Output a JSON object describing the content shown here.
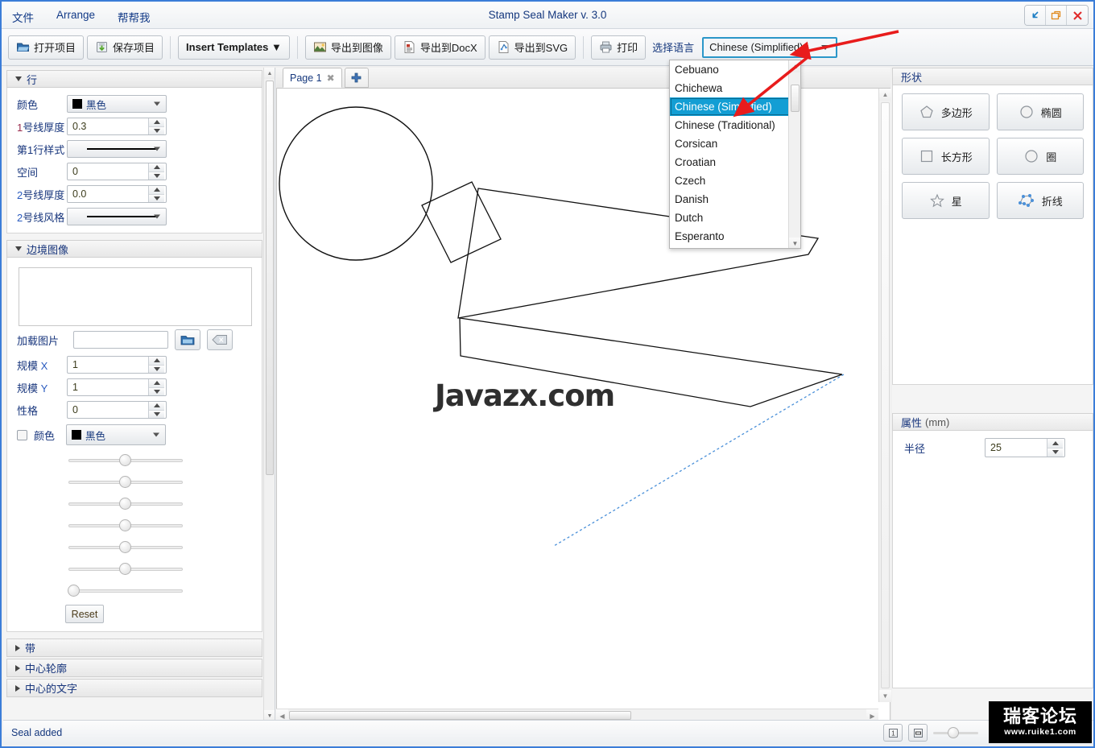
{
  "window": {
    "title": "Stamp Seal Maker v. 3.0",
    "menus": [
      "文件",
      "Arrange",
      "帮帮我"
    ],
    "controls": [
      {
        "name": "minimize-button",
        "glyph": "↙"
      },
      {
        "name": "restore-button",
        "glyph": "❐"
      },
      {
        "name": "close-button",
        "glyph": "✕"
      }
    ]
  },
  "toolbar": {
    "buttons": [
      {
        "label": "打开项目",
        "icon": "open-project-icon"
      },
      {
        "label": "保存项目",
        "icon": "save-project-icon"
      },
      {
        "label": "Insert Templates ▼",
        "icon": "none"
      },
      {
        "label": "导出到图像",
        "icon": "export-image-icon"
      },
      {
        "label": "导出到DocX",
        "icon": "export-docx-icon"
      },
      {
        "label": "导出到SVG",
        "icon": "export-svg-icon"
      },
      {
        "label": "打印",
        "icon": "print-icon"
      }
    ],
    "language_label": "选择语言",
    "language_value": "Chinese (Simplified)"
  },
  "language_dropdown": {
    "options": [
      "Cebuano",
      "Chichewa",
      "Chinese (Simplified)",
      "Chinese (Traditional)",
      "Corsican",
      "Croatian",
      "Czech",
      "Danish",
      "Dutch",
      "Esperanto"
    ],
    "selected": "Chinese (Simplified)",
    "selected_index": 2
  },
  "left_panel": {
    "sections": [
      {
        "title": "行",
        "expanded": true,
        "fields": [
          {
            "label": "颜色",
            "type": "color-combo",
            "value": "黑色",
            "swatch": "#000000"
          },
          {
            "label": "1号线厚度",
            "type": "spinner",
            "value": "0.3"
          },
          {
            "label": "第1行样式",
            "type": "line-style-combo",
            "value": "solid"
          },
          {
            "label": "空间",
            "type": "spinner",
            "value": "0"
          },
          {
            "label": "2号线厚度",
            "type": "spinner",
            "value": "0.0"
          },
          {
            "label": "2号线风格",
            "type": "line-style-combo",
            "value": "solid"
          }
        ]
      },
      {
        "title": "边境图像",
        "expanded": true,
        "fields": [
          {
            "label": "加载图片",
            "type": "file-field",
            "value": "",
            "placeholder": ""
          },
          {
            "label": "规模 X",
            "type": "spinner",
            "value": "1"
          },
          {
            "label": "规模 Y",
            "type": "spinner",
            "value": "1"
          },
          {
            "label": "性格",
            "type": "spinner",
            "value": "0"
          },
          {
            "label": "颜色",
            "type": "checkbox-color-combo",
            "value": "黑色",
            "swatch": "#000000",
            "checked": false
          }
        ],
        "sliders": [
          50,
          50,
          50,
          50,
          50,
          50,
          0
        ],
        "reset_label": "Reset"
      },
      {
        "title": "带",
        "expanded": false,
        "fields": []
      },
      {
        "title": "中心轮廓",
        "expanded": false,
        "fields": []
      },
      {
        "title": "中心的文字",
        "expanded": false,
        "fields": []
      }
    ]
  },
  "center": {
    "tabs": [
      {
        "label": "Page 1",
        "close": "✖",
        "active": true
      }
    ],
    "add_tab": "+",
    "canvas_watermark": "Javazx.com"
  },
  "right_panel": {
    "shapes_title": "形状",
    "shapes": [
      {
        "label": "多边形",
        "icon": "pentagon-icon"
      },
      {
        "label": "椭圆",
        "icon": "ellipse-icon"
      },
      {
        "label": "长方形",
        "icon": "rectangle-icon"
      },
      {
        "label": "圈",
        "icon": "circle-icon"
      },
      {
        "label": "星",
        "icon": "star-icon"
      },
      {
        "label": "折线",
        "icon": "polyline-icon"
      }
    ],
    "properties_title": "属性",
    "properties_unit": "(mm)",
    "properties": [
      {
        "label": "半径",
        "value": "25"
      }
    ]
  },
  "statusbar": {
    "message": "Seal added",
    "zoom_buttons": [
      {
        "name": "zoom-actual-size-button",
        "glyph": "1"
      },
      {
        "name": "zoom-fit-button",
        "glyph": "▬"
      }
    ],
    "zoom_slider_value": 33
  },
  "watermark": {
    "cn": "瑞客论坛",
    "url": "www.ruike1.com"
  },
  "colors": {
    "accent_blue": "#3b7dd8",
    "label_navy": "#17357c",
    "selection_cyan": "#139ed4",
    "arrow_red": "#e81c1c",
    "status_text": "#15387e"
  }
}
